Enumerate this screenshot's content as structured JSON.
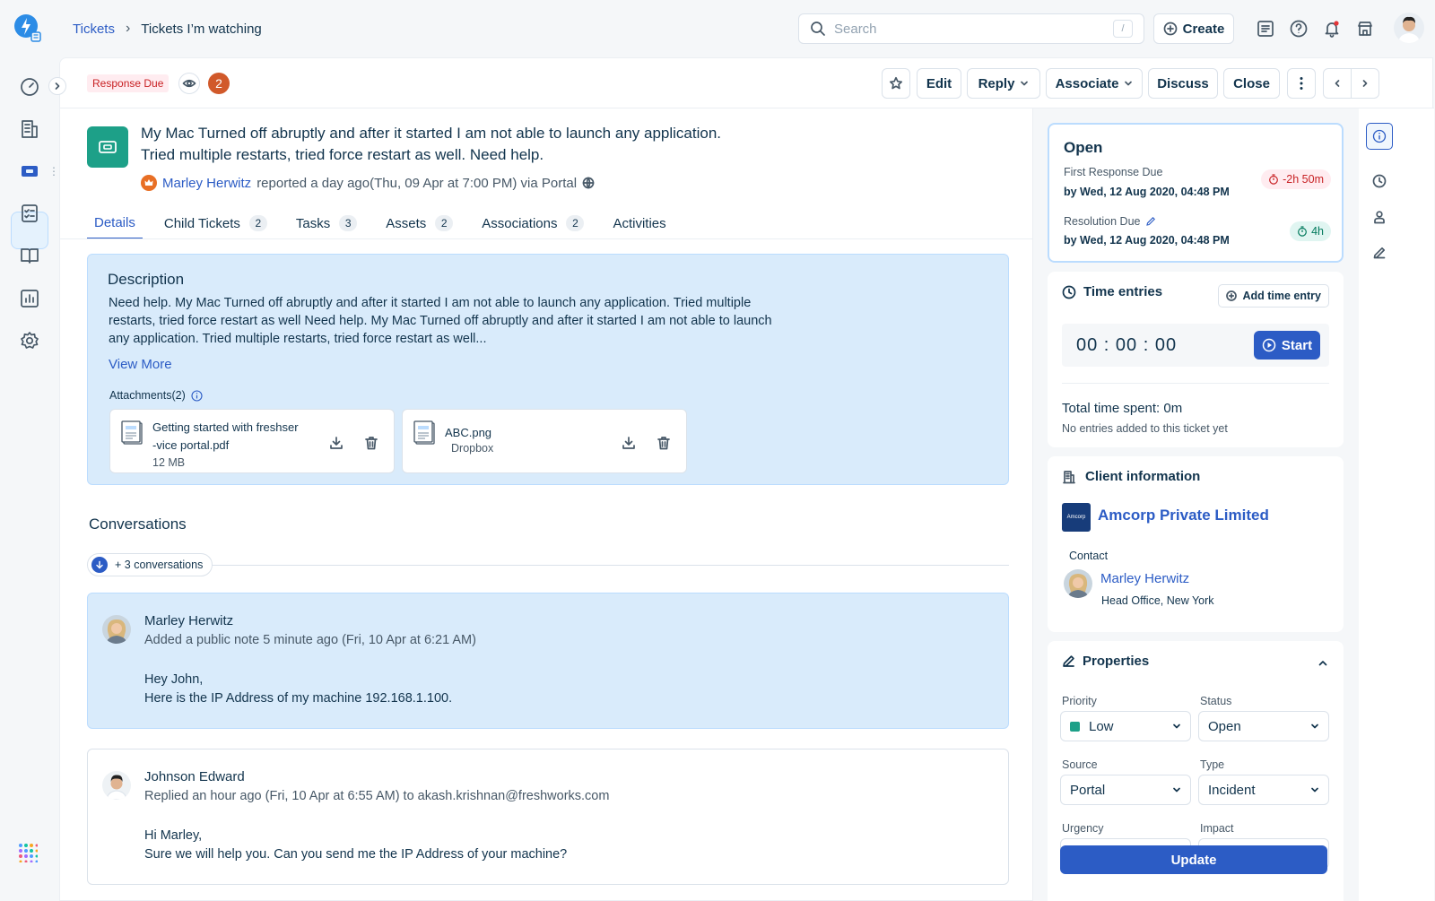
{
  "breadcrumb": {
    "root": "Tickets",
    "current": "Tickets I’m watching"
  },
  "search": {
    "placeholder": "Search",
    "shortcut": "/"
  },
  "header": {
    "create_label": "Create"
  },
  "colors": {
    "primary": "#2c5cc5",
    "ticket_icon": "#1da088",
    "badge_red": "#c82124",
    "watch_count": "#d1592a"
  },
  "actionbar": {
    "response_badge": "Response Due",
    "watch_count": "2",
    "edit": "Edit",
    "reply": "Reply",
    "associate": "Associate",
    "discuss": "Discuss",
    "close": "Close"
  },
  "ticket": {
    "subject_line1": "My Mac Turned off abruptly and after it started I am not able to launch any application.",
    "subject_line2": "Tried multiple restarts, tried force restart as well. Need help.",
    "reporter_name": "Marley Herwitz",
    "reported_text": "reported a day ago(Thu, 09 Apr at 7:00 PM) via Portal"
  },
  "tabs": [
    {
      "label": "Details",
      "count": ""
    },
    {
      "label": "Child Tickets",
      "count": "2"
    },
    {
      "label": "Tasks",
      "count": "3"
    },
    {
      "label": "Assets",
      "count": "2"
    },
    {
      "label": "Associations",
      "count": "2"
    },
    {
      "label": "Activities",
      "count": ""
    }
  ],
  "description": {
    "title": "Description",
    "line1": "Need help. My Mac Turned off abruptly and after it started I am not able to launch any application. Tried multiple",
    "line2": "restarts, tried force restart as well Need help. My Mac Turned off abruptly and after it started I am not able to launch",
    "line3": "any application. Tried multiple restarts, tried force restart as well...",
    "view_more": "View More",
    "attachments_label": "Attachments(2)",
    "attachments": [
      {
        "name_line1": "Getting started with freshser",
        "name_line2": "-vice portal.pdf",
        "meta": "12 MB"
      },
      {
        "name_line1": "ABC.png",
        "name_line2": "",
        "meta": "Dropbox"
      }
    ]
  },
  "conversations": {
    "title": "Conversations",
    "more_label": "+ 3 conversations",
    "items": [
      {
        "author": "Marley Herwitz",
        "meta": "Added a public note 5 minute ago (Fri, 10 Apr at 6:21 AM)",
        "line1": "Hey John,",
        "line2": "Here is the IP Address of my machine 192.168.1.100."
      },
      {
        "author": "Johnson Edward",
        "meta": "Replied an hour ago (Fri, 10 Apr at 6:55 AM) to akash.krishnan@freshworks.com",
        "line1": "Hi Marley,",
        "line2": "Sure we will help you. Can you send me the IP Address of your machine?"
      }
    ]
  },
  "status_card": {
    "status": "Open",
    "first_response_label": "First Response Due",
    "first_response_value": "by Wed, 12 Aug 2020, 04:48 PM",
    "first_response_pill": "-2h 50m",
    "resolution_label": "Resolution Due",
    "resolution_value": "by Wed, 12 Aug 2020, 04:48 PM",
    "resolution_pill": "4h"
  },
  "time_entries": {
    "title": "Time entries",
    "add_label": "Add time entry",
    "timer": "00 : 00 : 00",
    "start_label": "Start",
    "total": "Total time spent: 0m",
    "empty": "No entries added to this ticket yet"
  },
  "client": {
    "title": "Client information",
    "logo_text": "Amcorp",
    "company": "Amcorp Private Limited",
    "contact_label": "Contact",
    "contact_name": "Marley Herwitz",
    "contact_location": "Head Office, New York"
  },
  "properties": {
    "title": "Properties",
    "priority_label": "Priority",
    "priority_value": "Low",
    "status_label": "Status",
    "status_value": "Open",
    "source_label": "Source",
    "source_value": "Portal",
    "type_label": "Type",
    "type_value": "Incident",
    "urgency_label": "Urgency",
    "impact_label": "Impact",
    "update_label": "Update"
  }
}
